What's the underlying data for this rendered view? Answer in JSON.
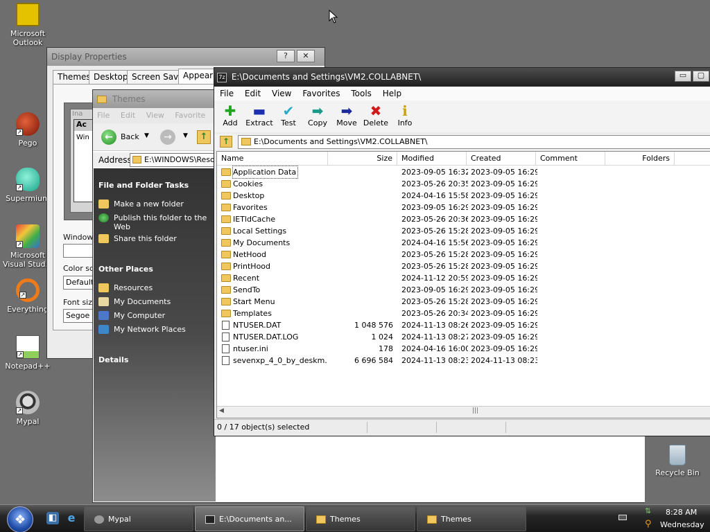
{
  "desktop": {
    "icons": [
      {
        "label": "Microsoft Outlook",
        "icon": "outlook-icon"
      },
      {
        "label": "Pego",
        "icon": "pego-icon"
      },
      {
        "label": "Supermium",
        "icon": "supermium-icon"
      },
      {
        "label": "Microsoft Visual Stud...",
        "icon": "visual-studio-icon"
      },
      {
        "label": "Everything",
        "icon": "everything-icon"
      },
      {
        "label": "Notepad++",
        "icon": "notepadpp-icon"
      },
      {
        "label": "Mypal",
        "icon": "mypal-icon"
      },
      {
        "label": "Recycle Bin",
        "icon": "recycle-bin-icon"
      }
    ]
  },
  "display_properties": {
    "title": "Display Properties",
    "help_glyph": "?",
    "close_glyph": "✕",
    "tabs": [
      "Themes",
      "Desktop",
      "Screen Saver",
      "Appearan"
    ],
    "preview_inactive": "Ina",
    "preview_active": "Ac",
    "preview_window": "Win",
    "windows_label": "Windows",
    "color_scheme_label": "Color sch",
    "color_scheme_value": "Default",
    "font_size_label": "Font size",
    "font_size_value": "Segoe U"
  },
  "themes_window": {
    "title": "Themes",
    "menu": [
      "File",
      "Edit",
      "View",
      "Favorite"
    ],
    "back_label": "Back",
    "address_label": "Address",
    "address_value": "E:\\WINDOWS\\Reso",
    "file_folder_tasks": {
      "heading": "File and Folder Tasks",
      "items": [
        "Make a new folder",
        "Publish this folder to the Web",
        "Share this folder"
      ]
    },
    "other_places": {
      "heading": "Other Places",
      "items": [
        "Resources",
        "My Documents",
        "My Computer",
        "My Network Places"
      ]
    },
    "details_heading": "Details"
  },
  "sevenzip": {
    "app_icon_text": "7z",
    "title": "E:\\Documents and Settings\\VM2.COLLABNET\\",
    "menu": [
      "File",
      "Edit",
      "View",
      "Favorites",
      "Tools",
      "Help"
    ],
    "toolbar": [
      {
        "label": "Add",
        "icon": "add-icon",
        "glyph": "✚",
        "color": "#1fa51f"
      },
      {
        "label": "Extract",
        "icon": "extract-icon",
        "glyph": "▬",
        "color": "#1c2fb0"
      },
      {
        "label": "Test",
        "icon": "test-icon",
        "glyph": "✔",
        "color": "#2aa9c9"
      },
      {
        "label": "Copy",
        "icon": "copy-icon",
        "glyph": "➡",
        "color": "#1a9b8a"
      },
      {
        "label": "Move",
        "icon": "move-icon",
        "glyph": "➡",
        "color": "#1c2b99"
      },
      {
        "label": "Delete",
        "icon": "delete-icon",
        "glyph": "✖",
        "color": "#d01a1a"
      },
      {
        "label": "Info",
        "icon": "info-icon",
        "glyph": "ℹ",
        "color": "#c9a200"
      }
    ],
    "path": "E:\\Documents and Settings\\VM2.COLLABNET\\",
    "columns": [
      "Name",
      "Size",
      "Modified",
      "Created",
      "Comment",
      "Folders"
    ],
    "rows": [
      {
        "name": "Application Data",
        "type": "folder",
        "size": "",
        "modified": "2023-09-05 16:32",
        "created": "2023-09-05 16:29"
      },
      {
        "name": "Cookies",
        "type": "folder",
        "size": "",
        "modified": "2023-05-26 20:35",
        "created": "2023-09-05 16:29"
      },
      {
        "name": "Desktop",
        "type": "folder",
        "size": "",
        "modified": "2024-04-16 15:58",
        "created": "2023-09-05 16:29"
      },
      {
        "name": "Favorites",
        "type": "folder",
        "size": "",
        "modified": "2023-09-05 16:29",
        "created": "2023-09-05 16:29"
      },
      {
        "name": "IETldCache",
        "type": "folder",
        "size": "",
        "modified": "2023-05-26 20:36",
        "created": "2023-09-05 16:29"
      },
      {
        "name": "Local Settings",
        "type": "folder",
        "size": "",
        "modified": "2023-05-26 15:28",
        "created": "2023-09-05 16:29"
      },
      {
        "name": "My Documents",
        "type": "folder",
        "size": "",
        "modified": "2024-04-16 15:56",
        "created": "2023-09-05 16:29"
      },
      {
        "name": "NetHood",
        "type": "folder",
        "size": "",
        "modified": "2023-05-26 15:28",
        "created": "2023-09-05 16:29"
      },
      {
        "name": "PrintHood",
        "type": "folder",
        "size": "",
        "modified": "2023-05-26 15:28",
        "created": "2023-09-05 16:29"
      },
      {
        "name": "Recent",
        "type": "folder",
        "size": "",
        "modified": "2024-11-12 20:59",
        "created": "2023-09-05 16:29"
      },
      {
        "name": "SendTo",
        "type": "folder",
        "size": "",
        "modified": "2023-09-05 16:29",
        "created": "2023-09-05 16:29"
      },
      {
        "name": "Start Menu",
        "type": "folder",
        "size": "",
        "modified": "2023-05-26 15:28",
        "created": "2023-09-05 16:29"
      },
      {
        "name": "Templates",
        "type": "folder",
        "size": "",
        "modified": "2023-05-26 20:34",
        "created": "2023-09-05 16:29"
      },
      {
        "name": "NTUSER.DAT",
        "type": "file",
        "size": "1 048 576",
        "modified": "2024-11-13 08:26",
        "created": "2023-09-05 16:29"
      },
      {
        "name": "NTUSER.DAT.LOG",
        "type": "file",
        "size": "1 024",
        "modified": "2024-11-13 08:27",
        "created": "2023-09-05 16:29"
      },
      {
        "name": "ntuser.ini",
        "type": "file",
        "size": "178",
        "modified": "2024-04-16 16:00",
        "created": "2023-09-05 16:29"
      },
      {
        "name": "sevenxp_4_0_by_deskm...",
        "type": "file",
        "size": "6 696 584",
        "modified": "2024-11-13 08:23",
        "created": "2024-11-13 08:23"
      }
    ],
    "status": "0 / 17 object(s) selected"
  },
  "taskbar": {
    "tasks": [
      {
        "label": "Mypal",
        "icon": "mypal-icon"
      },
      {
        "label": "E:\\Documents an...",
        "icon": "sevenzip-icon"
      },
      {
        "label": "Themes",
        "icon": "folder-icon"
      },
      {
        "label": "Themes",
        "icon": "folder-icon"
      }
    ],
    "clock_time": "8:28 AM",
    "clock_day": "Wednesday"
  }
}
